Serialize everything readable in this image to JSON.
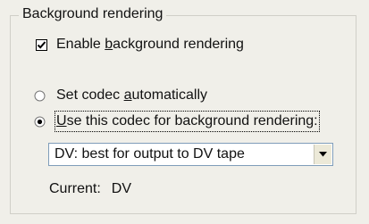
{
  "group": {
    "title": "Background rendering"
  },
  "enable_background": {
    "checked": true,
    "label_pre": "Enable ",
    "label_key": "b",
    "label_post": "ackground rendering"
  },
  "codec_auto": {
    "selected": false,
    "label_pre": "Set codec ",
    "label_key": "a",
    "label_post": "utomatically"
  },
  "codec_specific": {
    "selected": true,
    "label_pre": "",
    "label_key": "U",
    "label_post": "se this codec for background rendering:"
  },
  "codec_select": {
    "value": "DV: best for output to DV tape"
  },
  "current": {
    "label": "Current:",
    "value": "DV"
  },
  "icons": {
    "checkbox": "check-mark",
    "dropdown": "chevron-down"
  }
}
